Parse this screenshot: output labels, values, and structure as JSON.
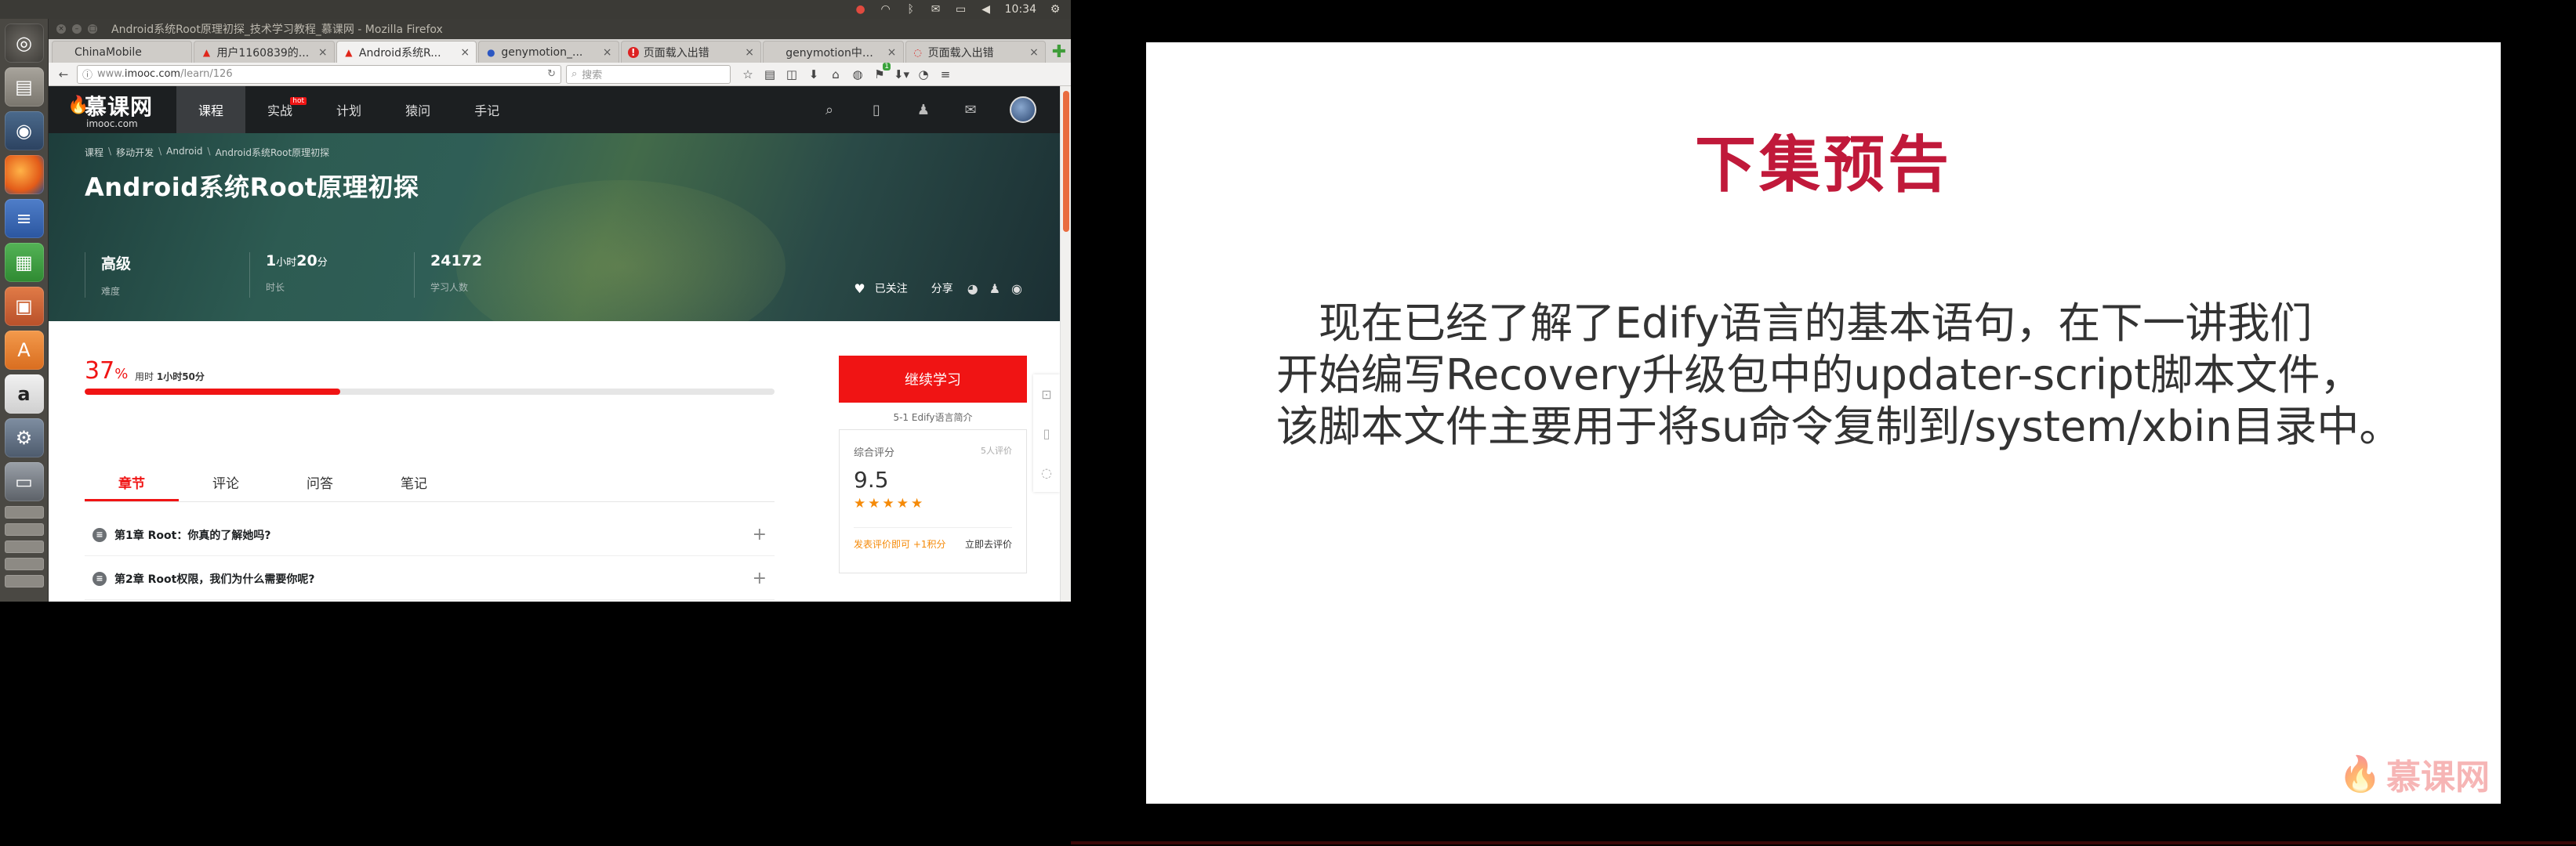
{
  "top_panel": {
    "time": "10:34",
    "icons": [
      "notification-icon",
      "wifi-icon",
      "bluetooth-icon",
      "mail-icon",
      "battery-icon",
      "volume-icon",
      "gear-icon"
    ]
  },
  "launcher": {
    "items": [
      "dash-icon",
      "files-icon",
      "media-icon",
      "firefox-icon",
      "writer-icon",
      "calc-icon",
      "impress-icon",
      "software-center-icon",
      "amazon-icon",
      "settings-icon",
      "drive-icon"
    ]
  },
  "firefox": {
    "window_title": "Android系统Root原理初探_技术学习教程_慕课网 - Mozilla Firefox",
    "tabs": [
      {
        "label": "ChinaMobile",
        "favicon": "",
        "active": false
      },
      {
        "label": "用户1160839的...",
        "favicon": "▲",
        "active": false
      },
      {
        "label": "Android系统R...",
        "favicon": "▲",
        "active": true
      },
      {
        "label": "genymotion_...",
        "favicon": "●",
        "active": false
      },
      {
        "label": "页面载入出错",
        "favicon": "!",
        "active": false
      },
      {
        "label": "genymotion中文...",
        "favicon": "",
        "active": false
      },
      {
        "label": "页面载入出错",
        "favicon": "◌",
        "active": false
      }
    ],
    "url_prefix": "www.",
    "url_host": "imooc.com",
    "url_path": "/learn/126",
    "search_placeholder": "搜索",
    "badge_count": "1"
  },
  "imooc": {
    "logo_cn": "慕课网",
    "logo_en": "imooc.com",
    "nav": [
      {
        "label": "课程",
        "active": true,
        "hot": false
      },
      {
        "label": "实战",
        "active": false,
        "hot": true
      },
      {
        "label": "计划",
        "active": false,
        "hot": false
      },
      {
        "label": "猿问",
        "active": false,
        "hot": false
      },
      {
        "label": "手记",
        "active": false,
        "hot": false
      }
    ],
    "hot_badge": "hot",
    "breadcrumb": [
      "课程",
      "移动开发",
      "Android",
      "Android系统Root原理初探"
    ],
    "course_title": "Android系统Root原理初探",
    "stats": {
      "level": {
        "value": "高级",
        "label": "难度"
      },
      "duration": {
        "hours": "1",
        "hour_unit": "小时",
        "minutes": "20",
        "minute_unit": "分",
        "label": "时长"
      },
      "learners": {
        "value": "24172",
        "label": "学习人数"
      }
    },
    "follow_label": "已关注",
    "share_label": "分享",
    "progress": {
      "percent_value": "37",
      "percent_sign": "%",
      "fraction": 0.37,
      "used_prefix": "用时",
      "used_time": "1小时50分"
    },
    "tabs": [
      {
        "label": "章节",
        "active": true
      },
      {
        "label": "评论",
        "active": false
      },
      {
        "label": "问答",
        "active": false
      },
      {
        "label": "笔记",
        "active": false
      }
    ],
    "chapters": [
      {
        "title": "第1章 Root：你真的了解她吗?"
      },
      {
        "title": "第2章 Root权限，我们为什么需要你呢?"
      }
    ],
    "continue_button": "继续学习",
    "next_lesson": "5-1 Edify语言简介",
    "rating": {
      "label": "综合评分",
      "count": "5人评价",
      "score": "9.5",
      "stars": "★★★★★",
      "promo": "发表评价即可 +1积分",
      "link": "立即去评价"
    }
  },
  "slide": {
    "title": "下集预告",
    "lines": [
      "　现在已经了解了Edify语言的基本语句，在下一讲我们",
      "开始编写Recovery升级包中的updater-script脚本文件，",
      "该脚本文件主要用于将su命令复制到/system/xbin目录中。"
    ],
    "watermark": "慕课网"
  }
}
